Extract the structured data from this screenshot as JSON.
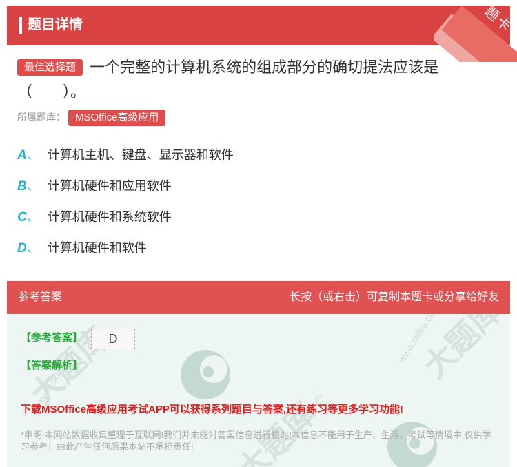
{
  "header": {
    "title": "题目详情",
    "corner_badge": "题卡"
  },
  "question": {
    "type_tag": "最佳选择题",
    "text": "一个完整的计算机系统的组成部分的确切提法应该是（　　）。"
  },
  "bank": {
    "label": "所属题库：",
    "name": "MSOffice高级应用"
  },
  "options": [
    {
      "letter": "A",
      "sep": "、",
      "text": "计算机主机、键盘、显示器和软件"
    },
    {
      "letter": "B",
      "sep": "、",
      "text": "计算机硬件和应用软件"
    },
    {
      "letter": "C",
      "sep": "、",
      "text": "计算机硬件和系统软件"
    },
    {
      "letter": "D",
      "sep": "、",
      "text": "计算机硬件和软件"
    }
  ],
  "answer_bar": {
    "left": "参考答案",
    "right": "长按（或右击）可复制本题卡或分享给好友"
  },
  "answer": {
    "ref_label": "【参考答案】",
    "ref_value": "D",
    "analysis_label": "【答案解析】"
  },
  "download_text": "下载MSOffice高级应用考试APP可以获得系列题目与答案,还有练习等更多学习功能!",
  "disclaimer": "*申明:本网站数据收集整理于互联网!我们并未能对答案信息进行核对!本信息不能用于生产、生活、考试等情境中,仅供学习参考！由此产生任何后果本站不承担责任!",
  "watermark": {
    "site": "www.stdku.com",
    "brand": "大题库"
  },
  "colors": {
    "accent_red": "#d94343",
    "option_letter": "#27b4c6",
    "answer_green": "#2aaa3c",
    "download_red": "#e01c1c"
  }
}
